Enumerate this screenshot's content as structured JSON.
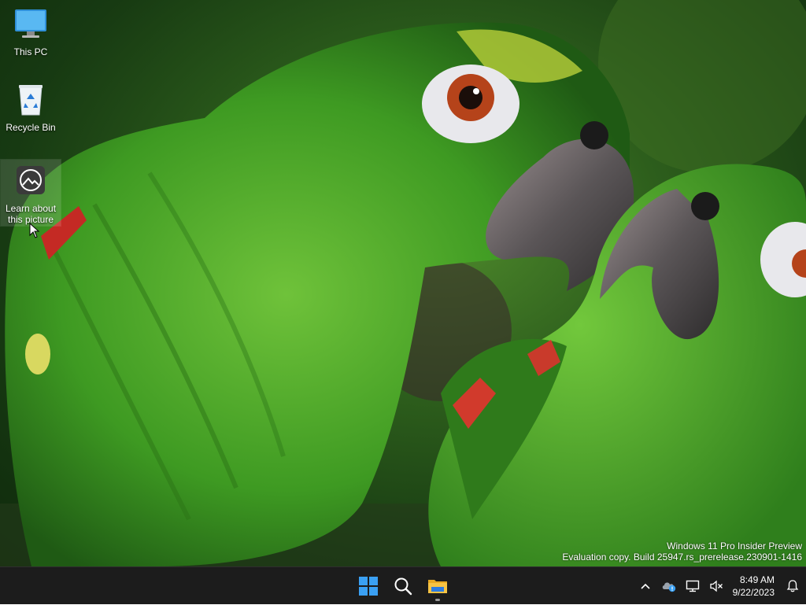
{
  "desktop": {
    "icons": [
      {
        "label": "This PC"
      },
      {
        "label": "Recycle Bin"
      },
      {
        "label_line1": "Learn about",
        "label_line2": "this picture"
      }
    ],
    "watermark": {
      "line1": "Windows 11 Pro Insider Preview",
      "line2": "Evaluation copy. Build 25947.rs_prerelease.230901-1416"
    }
  },
  "taskbar": {
    "pinned": [
      {
        "icon": "windows-start-icon"
      },
      {
        "icon": "search-icon"
      },
      {
        "icon": "file-explorer-icon"
      }
    ],
    "tray": {
      "icons": [
        "chevron-up-icon",
        "onedrive-icon",
        "network-icon",
        "volume-muted-icon"
      ],
      "time": "8:49 AM",
      "date": "9/22/2023",
      "notification_icon": "bell-icon"
    }
  },
  "colors": {
    "taskbar_bg": "#1c1c1c",
    "windows_blue": "#3aa0f3",
    "folder_yellow": "#f6c344",
    "parrot_green": "#4fa82a"
  }
}
